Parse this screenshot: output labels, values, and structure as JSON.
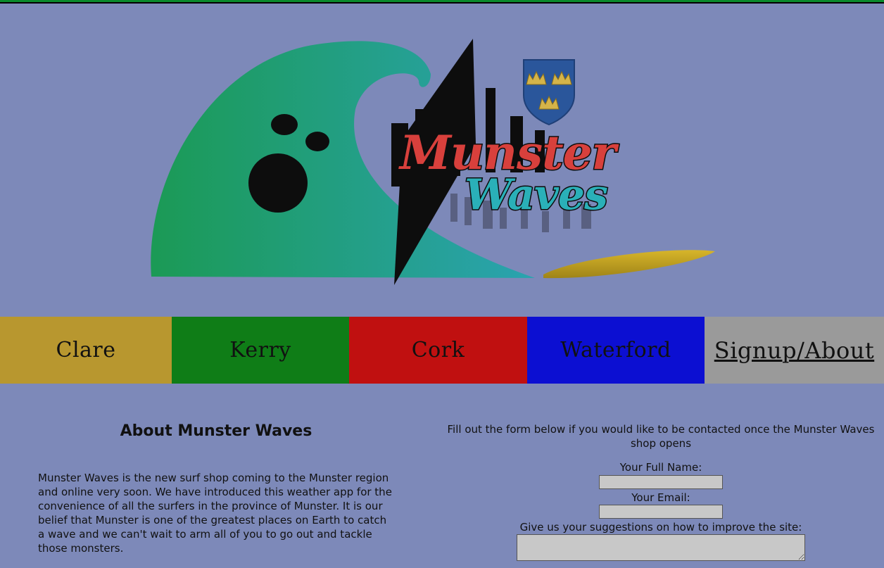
{
  "logo": {
    "line1": "Munster",
    "line2": "Waves"
  },
  "nav": {
    "items": [
      {
        "label": "Clare",
        "color": "#b8972f"
      },
      {
        "label": "Kerry",
        "color": "#0f7d17"
      },
      {
        "label": "Cork",
        "color": "#c01010"
      },
      {
        "label": "Waterford",
        "color": "#0c0fd2"
      },
      {
        "label": "Signup/About",
        "color": "#9a9a9a"
      }
    ]
  },
  "about": {
    "title": "About Munster Waves",
    "body": "Munster Waves is the new surf shop coming to the Munster region and online very soon. We have introduced this weather app for the convenience of all the surfers in the province of Munster. It is our belief that Munster is one of the greatest places on Earth to catch a wave and we can't wait to arm all of you to go out and tackle those monsters."
  },
  "signup": {
    "intro": "Fill out the form below if you would like to be contacted once the Munster Waves shop opens",
    "name_label": "Your Full Name:",
    "email_label": "Your Email:",
    "suggest_label": "Give us your suggestions on how to improve the site:",
    "name_value": "",
    "email_value": "",
    "suggest_value": ""
  },
  "colors": {
    "background": "#7d89b9",
    "wave_start": "#1b9a55",
    "wave_end": "#2a9fa8",
    "munster_red": "#d8403c",
    "waves_teal": "#2ab0b8"
  }
}
